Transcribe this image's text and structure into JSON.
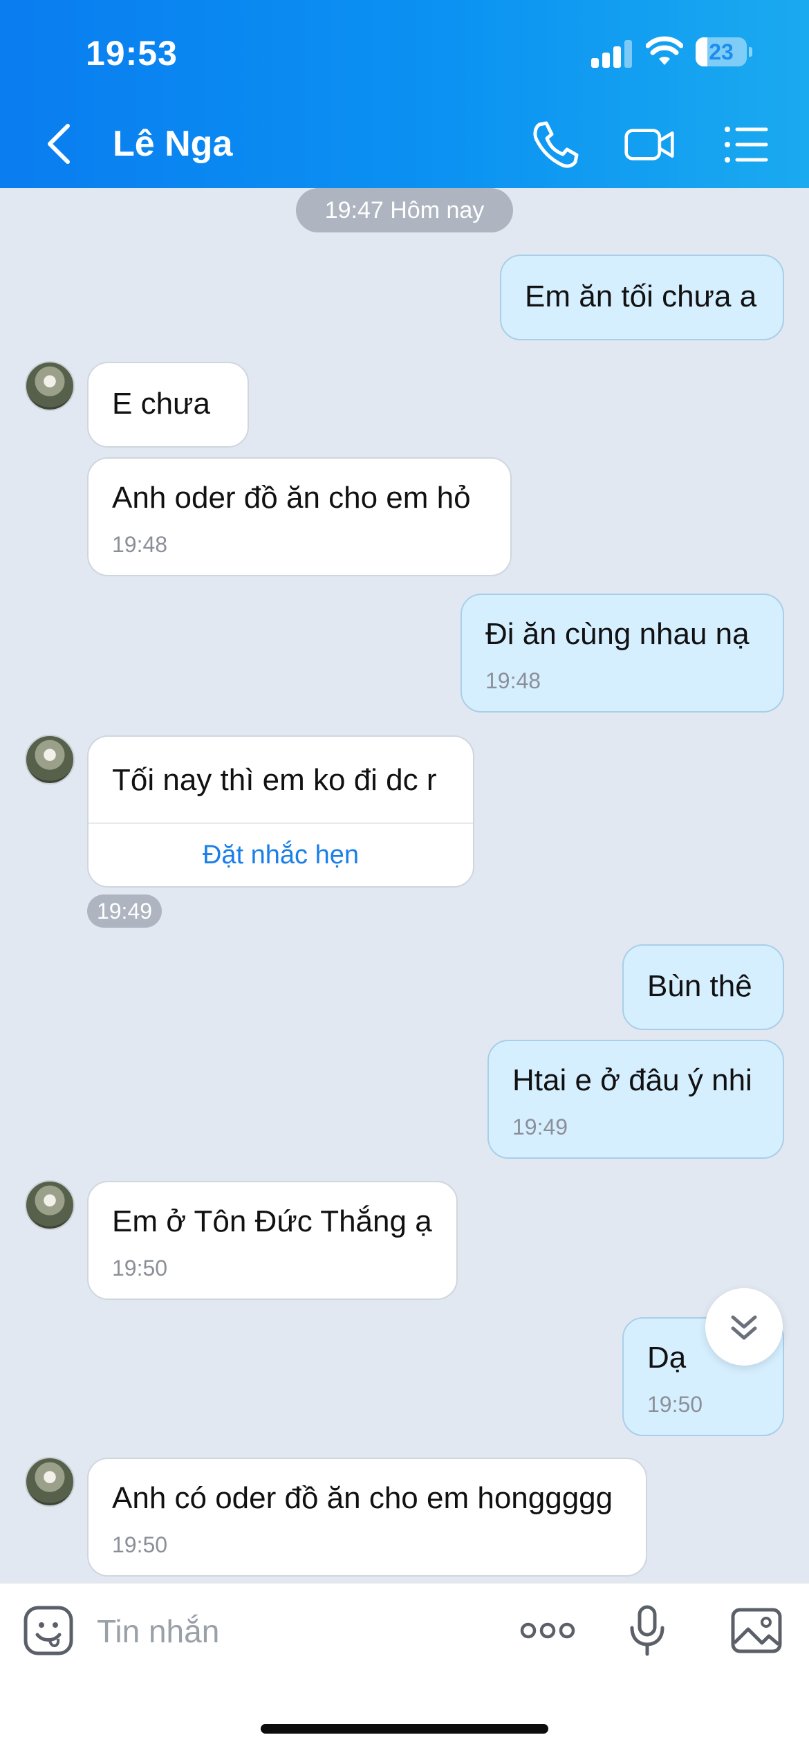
{
  "status_bar": {
    "time": "19:53",
    "battery": "23",
    "battery_level_percent": 23
  },
  "header": {
    "contact_name": "Lê Nga",
    "icons": [
      "back-icon",
      "phone-icon",
      "video-call-icon",
      "menu-list-icon"
    ]
  },
  "date_separator": "19:47 Hôm nay",
  "messages": [
    {
      "side": "out",
      "text": "Em ăn tối chưa a",
      "time": ""
    },
    {
      "side": "in",
      "text": "E chưa",
      "time": ""
    },
    {
      "side": "in",
      "text": "Anh oder đồ ăn cho em hỏ",
      "time": "19:48"
    },
    {
      "side": "out",
      "text": "Đi ăn cùng nhau nạ",
      "time": "19:48"
    },
    {
      "side": "in",
      "text": "Tối nay thì em ko đi dc r",
      "action": "Đặt nhắc hẹn",
      "time": "19:49"
    },
    {
      "side": "out",
      "text": "Bùn thê",
      "time": ""
    },
    {
      "side": "out",
      "text": "Htai e ở đâu ý nhi",
      "time": "19:49"
    },
    {
      "side": "in",
      "text": "Em ở Tôn Đức Thắng ạ",
      "time": "19:50"
    },
    {
      "side": "out",
      "text": "Dạ",
      "time": "19:50"
    },
    {
      "side": "in",
      "text": "Anh có oder đồ ăn cho em honggggg",
      "time": "19:50"
    }
  ],
  "composer": {
    "placeholder": "Tin nhắn",
    "icons": [
      "sticker-icon",
      "more-dots-icon",
      "microphone-icon",
      "image-icon"
    ]
  },
  "colors": {
    "header_blue": "#0a7df0",
    "chat_background": "#e2e8f1",
    "outgoing_bubble": "#d6efff",
    "incoming_bubble": "#ffffff",
    "link_blue": "#1a7fe8"
  }
}
